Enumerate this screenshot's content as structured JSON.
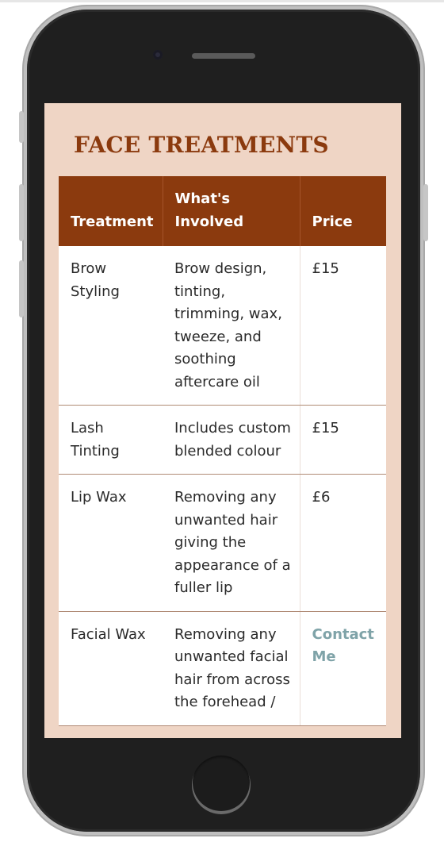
{
  "section": {
    "title": "FACE TREATMENTS"
  },
  "table": {
    "headers": {
      "treatment": "Treatment",
      "involved": "What's Involved",
      "price": "Price"
    },
    "rows": [
      {
        "treatment": "Brow Styling",
        "involved": "Brow design, tinting, trimming, wax, tweeze, and soothing aftercare oil",
        "price": "£15"
      },
      {
        "treatment": "Lash Tinting",
        "involved": "Includes custom blended colour",
        "price": "£15"
      },
      {
        "treatment": "Lip Wax",
        "involved": "Removing any unwanted hair giving the appearance of a fuller lip",
        "price": "£6"
      },
      {
        "treatment": "Facial Wax",
        "involved": "Removing any unwanted facial hair from across the forehead /",
        "price_link": "Contact Me"
      }
    ]
  },
  "colors": {
    "accent": "#8b3a0e",
    "page_background": "#efd5c5",
    "link": "#7fa3a8"
  }
}
